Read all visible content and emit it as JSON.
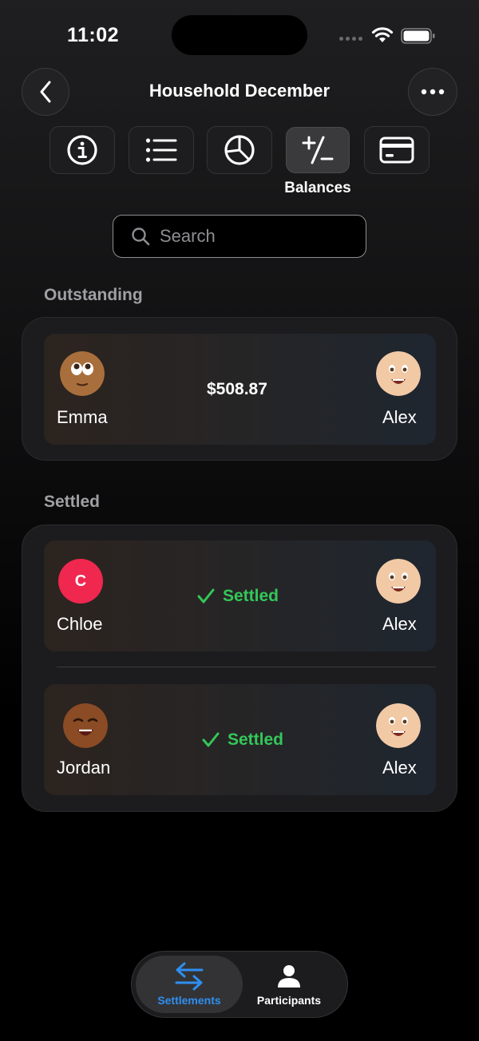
{
  "status_bar": {
    "time": "11:02"
  },
  "header": {
    "title": "Household December"
  },
  "tabs": {
    "items": [
      "info",
      "list",
      "pie",
      "balances",
      "card"
    ],
    "active_label": "Balances"
  },
  "search": {
    "placeholder": "Search"
  },
  "outstanding": {
    "title": "Outstanding",
    "rows": [
      {
        "from": "Emma",
        "amount": "$508.87",
        "to": "Alex"
      }
    ]
  },
  "settled": {
    "title": "Settled",
    "rows": [
      {
        "from": "Chloe",
        "from_initial": "C",
        "status": "Settled",
        "to": "Alex"
      },
      {
        "from": "Jordan",
        "status": "Settled",
        "to": "Alex"
      }
    ]
  },
  "bottom_nav": {
    "settlements_label": "Settlements",
    "participants_label": "Participants"
  },
  "colors": {
    "accent_blue": "#2f8ff0",
    "settled_green": "#34c759",
    "chloe_avatar": "#f0274f"
  }
}
